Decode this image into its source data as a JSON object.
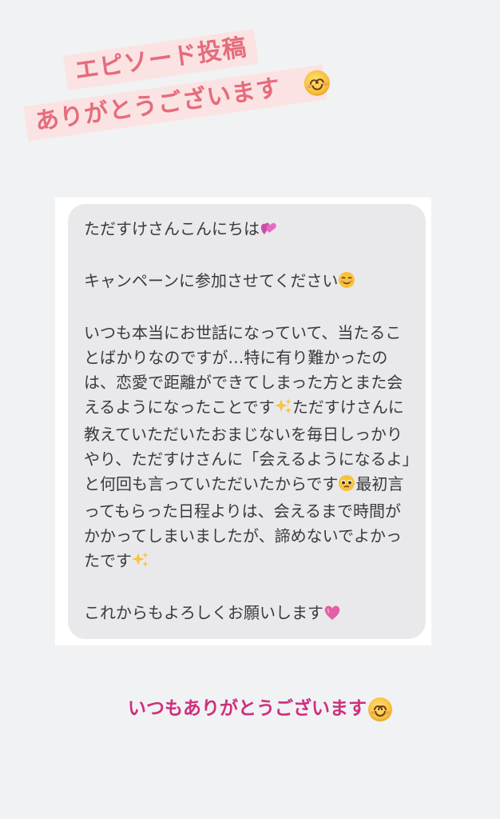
{
  "banner": {
    "line1": "エピソード投稿",
    "line2": "ありがとうございます",
    "emoji": "smiling-face-icon"
  },
  "message": {
    "greeting": "ただすけさんこんにちは",
    "greeting_emoji": "two-hearts-icon",
    "request": "キャンペーンに参加させてください",
    "request_emoji": "relieved-face-icon",
    "body_part1": "いつも本当にお世話になっていて、当たることばかりなのですが…特に有り難かったのは、恋愛で距離ができてしまった方とまた会えるようになったことです",
    "sparkle_icon": "sparkles-icon",
    "body_part2": "ただすけさんに教えていただいたおまじないを毎日しっかりやり、ただすけさんに「会えるようになるよ」と何回も言っていただいたからです",
    "pleading_icon": "pleading-face-icon",
    "body_part3": "最初言ってもらった日程よりは、会えるまで時間がかかってしまいましたが、諦めないでよかったです",
    "closing": "これからもよろしくお願いします",
    "closing_emoji": "pink-heart-icon"
  },
  "footer": {
    "thanks": "いつもありがとうございます",
    "emoji": "smiling-face-icon"
  },
  "colors": {
    "banner_bg": "#fbe3e3",
    "banner_text": "#e56c7c",
    "bubble_bg": "#e9e9eb",
    "thanks_text": "#cf2f7e"
  }
}
